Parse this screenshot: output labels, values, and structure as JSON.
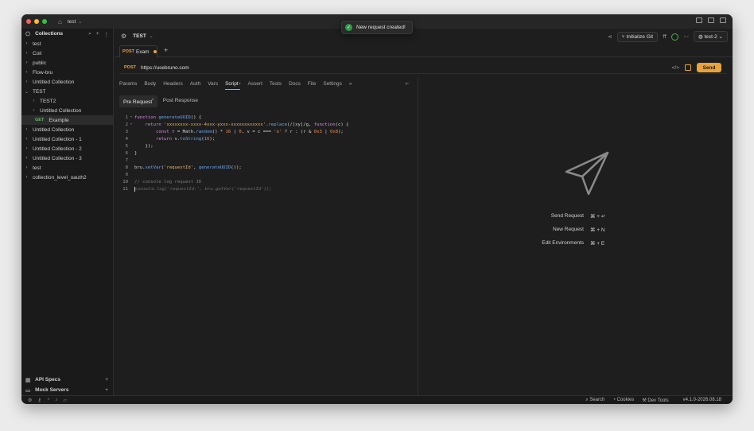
{
  "workspace": {
    "name": "test"
  },
  "sidebar": {
    "title": "Collections",
    "items": [
      {
        "label": "test",
        "depth": 0,
        "chevron": "right"
      },
      {
        "label": "Coil",
        "depth": 0,
        "chevron": "right"
      },
      {
        "label": "public",
        "depth": 0,
        "chevron": "right"
      },
      {
        "label": "Flow-bru",
        "depth": 0,
        "chevron": "right"
      },
      {
        "label": "Untitled Collection",
        "depth": 0,
        "chevron": "right"
      },
      {
        "label": "TEST",
        "depth": 0,
        "chevron": "down"
      },
      {
        "label": "TEST2",
        "depth": 1,
        "chevron": "right"
      },
      {
        "label": "Untitled Collection",
        "depth": 1,
        "chevron": "right"
      },
      {
        "label": "Example",
        "depth": 1,
        "method": "GET",
        "active": true
      },
      {
        "label": "Untitled Collection",
        "depth": 0,
        "chevron": "right"
      },
      {
        "label": "Untitled Collection - 1",
        "depth": 0,
        "chevron": "right"
      },
      {
        "label": "Untitled Collection - 2",
        "depth": 0,
        "chevron": "right"
      },
      {
        "label": "Untitled Collection - 3",
        "depth": 0,
        "chevron": "right"
      },
      {
        "label": "test",
        "depth": 0,
        "chevron": "right"
      },
      {
        "label": "collection_level_oauth2",
        "depth": 0,
        "chevron": "right"
      }
    ],
    "bottom": {
      "api_specs": "API Specs",
      "mock_servers": "Mock Servers"
    }
  },
  "topbar": {
    "collection": "TEST",
    "git_button": "Initialize Git",
    "environment": "test-2"
  },
  "tab": {
    "method": "POST",
    "name": "Exam"
  },
  "request": {
    "method": "POST",
    "url": "https://usebruno.com",
    "send_label": "Send"
  },
  "subtabs": [
    "Params",
    "Body",
    "Headers",
    "Auth",
    "Vars",
    "Script",
    "Assert",
    "Tests",
    "Docs",
    "File",
    "Settings"
  ],
  "active_subtab": "Script",
  "script_tabs": {
    "pre": "Pre Request",
    "post": "Post Response"
  },
  "code_lines": [
    "function generateUUID() {",
    "    return 'xxxxxxxx-xxxx-4xxx-yxxx-xxxxxxxxxxxx'.replace(/[xy]/g, function(c) {",
    "        const r = Math.random() * 16 | 0, v = c === 'x' ? r : (r & 0x3 | 0x8);",
    "        return v.toString(16);",
    "    });",
    "}",
    "",
    "bru.setVar('requestId', generateUUID());",
    "",
    "// console log request ID",
    "console.log('requestId:', bru.getVar('requestId'));"
  ],
  "shortcuts": [
    {
      "label": "Send Request",
      "keys": "⌘ + ↵"
    },
    {
      "label": "New Request",
      "keys": "⌘ + N"
    },
    {
      "label": "Edit Environments",
      "keys": "⌘ + E"
    }
  ],
  "statusbar": {
    "search": "Search",
    "cookies": "Cookies",
    "dev_tools": "Dev Tools",
    "version": "v4.1.0-2026.08.18"
  },
  "toast": {
    "message": "New request created!"
  },
  "colors": {
    "accent": "#e8a33c",
    "post": "#f0a13a",
    "get": "#65b665",
    "success": "#2e9c4a"
  }
}
